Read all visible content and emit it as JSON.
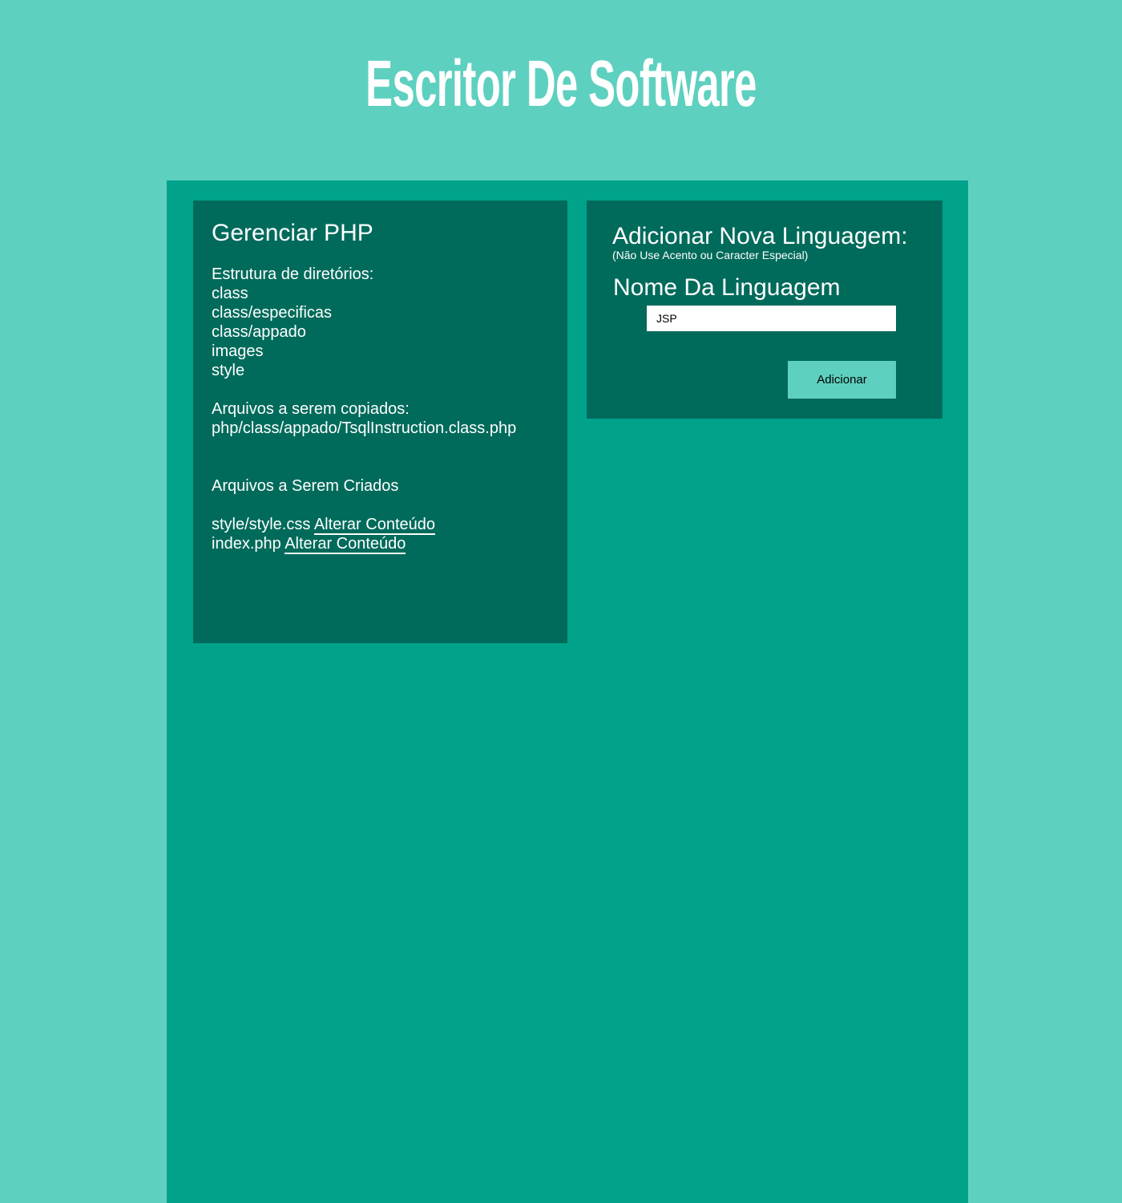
{
  "header": {
    "title": "Escritor De Software"
  },
  "manage_panel": {
    "title": "Gerenciar PHP",
    "dirs_label": "Estrutura de diretórios:",
    "dirs": [
      "class",
      "class/especificas",
      "class/appado",
      "images",
      "style"
    ],
    "copy_label": "Arquivos a serem copiados:",
    "copy_files": [
      "php/class/appado/TsqlInstruction.class.php"
    ],
    "create_label": "Arquivos a Serem Criados",
    "create_files": [
      {
        "name": "style/style.css",
        "link": "Alterar Conteúdo"
      },
      {
        "name": "index.php",
        "link": "Alterar Conteúdo"
      }
    ]
  },
  "add_panel": {
    "title": "Adicionar Nova Linguagem:",
    "note": "(Não Use Acento ou Caracter Especial)",
    "field_label": "Nome Da Linguagem",
    "field_value": "JSP",
    "button_label": "Adicionar"
  },
  "colors": {
    "page_bg": "#5ed0bf",
    "container_bg": "#00a28a",
    "panel_bg": "#006b5b",
    "button_bg": "#5ed0bf"
  }
}
